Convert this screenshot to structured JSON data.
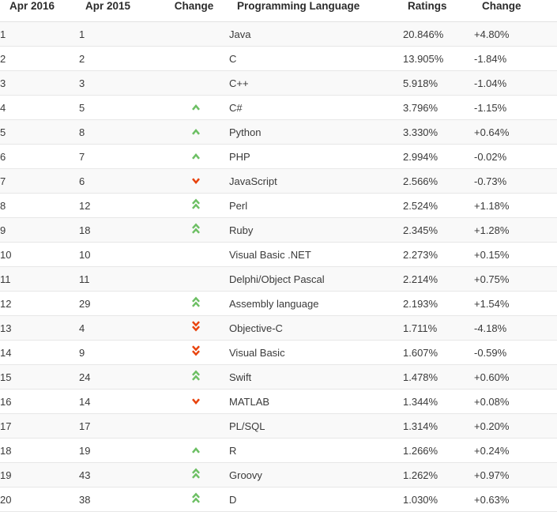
{
  "table": {
    "headers": {
      "rank_current": "Apr 2016",
      "rank_previous": "Apr 2015",
      "change_arrow": "Change",
      "language": "Programming Language",
      "ratings": "Ratings",
      "change": "Change"
    },
    "rows": [
      {
        "rank_current": "1",
        "rank_previous": "1",
        "trend": "none",
        "language": "Java",
        "ratings": "20.846%",
        "change": "+4.80%"
      },
      {
        "rank_current": "2",
        "rank_previous": "2",
        "trend": "none",
        "language": "C",
        "ratings": "13.905%",
        "change": "-1.84%"
      },
      {
        "rank_current": "3",
        "rank_previous": "3",
        "trend": "none",
        "language": "C++",
        "ratings": "5.918%",
        "change": "-1.04%"
      },
      {
        "rank_current": "4",
        "rank_previous": "5",
        "trend": "up",
        "language": "C#",
        "ratings": "3.796%",
        "change": "-1.15%"
      },
      {
        "rank_current": "5",
        "rank_previous": "8",
        "trend": "up",
        "language": "Python",
        "ratings": "3.330%",
        "change": "+0.64%"
      },
      {
        "rank_current": "6",
        "rank_previous": "7",
        "trend": "up",
        "language": "PHP",
        "ratings": "2.994%",
        "change": "-0.02%"
      },
      {
        "rank_current": "7",
        "rank_previous": "6",
        "trend": "down",
        "language": "JavaScript",
        "ratings": "2.566%",
        "change": "-0.73%"
      },
      {
        "rank_current": "8",
        "rank_previous": "12",
        "trend": "double-up",
        "language": "Perl",
        "ratings": "2.524%",
        "change": "+1.18%"
      },
      {
        "rank_current": "9",
        "rank_previous": "18",
        "trend": "double-up",
        "language": "Ruby",
        "ratings": "2.345%",
        "change": "+1.28%"
      },
      {
        "rank_current": "10",
        "rank_previous": "10",
        "trend": "none",
        "language": "Visual Basic .NET",
        "ratings": "2.273%",
        "change": "+0.15%"
      },
      {
        "rank_current": "11",
        "rank_previous": "11",
        "trend": "none",
        "language": "Delphi/Object Pascal",
        "ratings": "2.214%",
        "change": "+0.75%"
      },
      {
        "rank_current": "12",
        "rank_previous": "29",
        "trend": "double-up",
        "language": "Assembly language",
        "ratings": "2.193%",
        "change": "+1.54%"
      },
      {
        "rank_current": "13",
        "rank_previous": "4",
        "trend": "double-down",
        "language": "Objective-C",
        "ratings": "1.711%",
        "change": "-4.18%"
      },
      {
        "rank_current": "14",
        "rank_previous": "9",
        "trend": "double-down",
        "language": "Visual Basic",
        "ratings": "1.607%",
        "change": "-0.59%"
      },
      {
        "rank_current": "15",
        "rank_previous": "24",
        "trend": "double-up",
        "language": "Swift",
        "ratings": "1.478%",
        "change": "+0.60%"
      },
      {
        "rank_current": "16",
        "rank_previous": "14",
        "trend": "down",
        "language": "MATLAB",
        "ratings": "1.344%",
        "change": "+0.08%"
      },
      {
        "rank_current": "17",
        "rank_previous": "17",
        "trend": "none",
        "language": "PL/SQL",
        "ratings": "1.314%",
        "change": "+0.20%"
      },
      {
        "rank_current": "18",
        "rank_previous": "19",
        "trend": "up",
        "language": "R",
        "ratings": "1.266%",
        "change": "+0.24%"
      },
      {
        "rank_current": "19",
        "rank_previous": "43",
        "trend": "double-up",
        "language": "Groovy",
        "ratings": "1.262%",
        "change": "+0.97%"
      },
      {
        "rank_current": "20",
        "rank_previous": "38",
        "trend": "double-up",
        "language": "D",
        "ratings": "1.030%",
        "change": "+0.63%"
      }
    ]
  },
  "icons": {
    "up": "chevron-up-icon",
    "double-up": "double-chevron-up-icon",
    "down": "chevron-down-icon",
    "double-down": "double-chevron-down-icon"
  },
  "colors": {
    "trend_up": "#6cbf63",
    "trend_down": "#e8430d",
    "stripe_background": "#f9f9f9",
    "row_border": "#e7e7e7",
    "header_border": "#e2e2e2",
    "text": "#3a3a3a"
  }
}
